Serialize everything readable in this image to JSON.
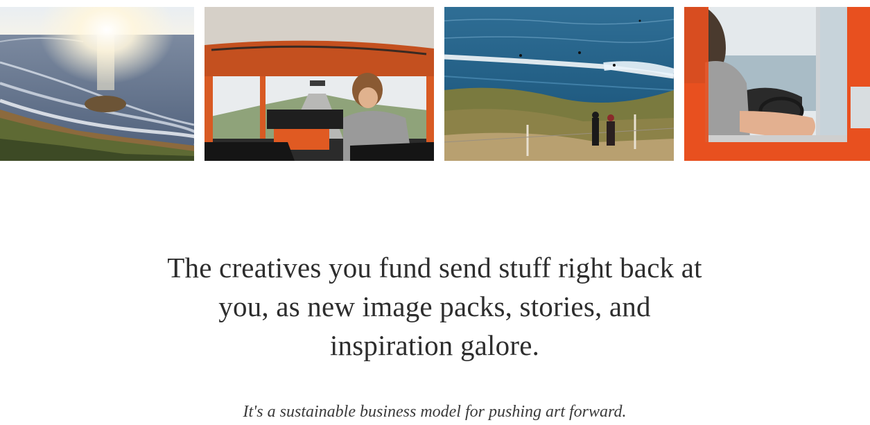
{
  "gallery": {
    "photos": [
      {
        "subject": "coastal-sunset-photo"
      },
      {
        "subject": "van-interior-driving-photo"
      },
      {
        "subject": "surfers-ocean-coast-photo"
      },
      {
        "subject": "orange-van-window-arm-photo"
      }
    ]
  },
  "content": {
    "headline": "The creatives you fund send stuff right back at you, as new image packs, stories, and inspiration galore.",
    "tagline": "It's a sustainable business model for pushing art forward."
  },
  "colors": {
    "text": "#2d2d2d",
    "background": "#ffffff",
    "van_orange": "#e8501f"
  }
}
